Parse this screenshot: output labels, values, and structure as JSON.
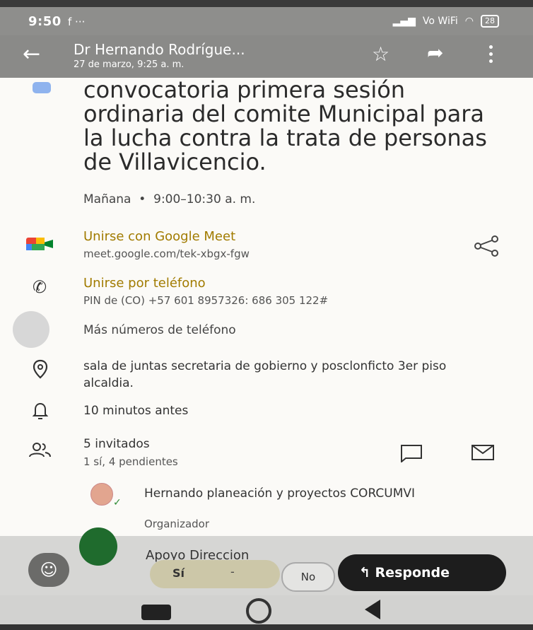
{
  "status_bar": {
    "time": "9:50",
    "notif": "f ···",
    "network": "Vo WiFi",
    "battery": "28"
  },
  "app_bar": {
    "title": "Dr Hernando Rodrígue...",
    "subtitle": "27 de marzo, 9:25 a. m."
  },
  "event": {
    "title": "convocatoria primera sesión ordinaria del comite Municipal para la lucha contra la trata de personas de Villavicencio.",
    "day": "Mañana",
    "time_range": "9:00–10:30 a. m."
  },
  "meet": {
    "label": "Unirse con Google Meet",
    "link": "meet.google.com/tek-xbgx-fgw"
  },
  "phone": {
    "label": "Unirse por teléfono",
    "pin": "PIN de (CO) +57 601 8957326: 686 305 122#"
  },
  "more_numbers": "Más números de teléfono",
  "location": "sala de juntas secretaria de gobierno y posclonficto 3er piso alcaldia.",
  "reminder": "10 minutos antes",
  "guests": {
    "count_label": "5 invitados",
    "status": "1 sí, 4 pendientes"
  },
  "organizer": {
    "name": "Hernando planeación y proyectos CORCUMVI",
    "role": "Organizador"
  },
  "next_guest_partial": "Apoyo Direccion",
  "rsvp": {
    "yes": "Sí",
    "dash": "-",
    "no": "No",
    "respond": "Responde"
  },
  "colors": {
    "accent_gold": "#a17b00",
    "calendar_blue": "#8fb3ee",
    "bar_grey": "#8a8a88"
  }
}
